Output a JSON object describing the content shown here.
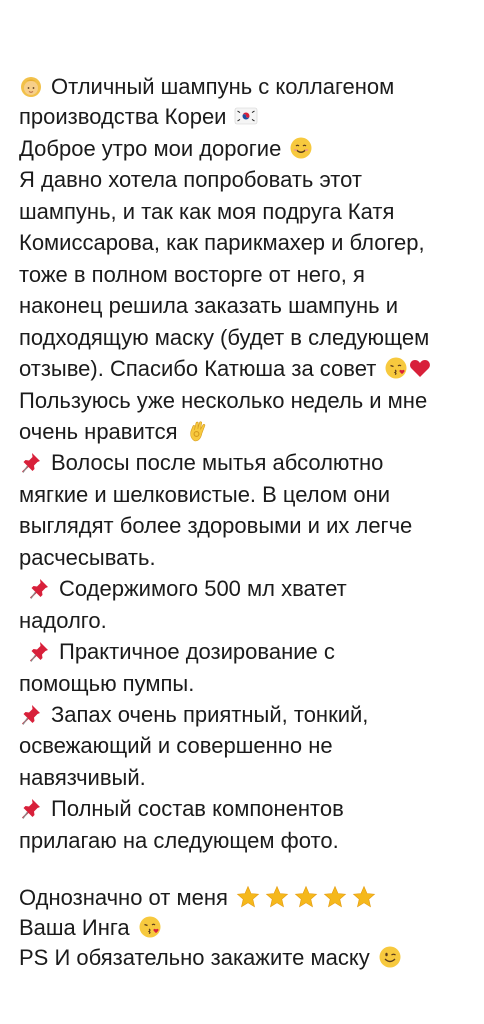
{
  "lines": [
    "Отличный шампунь с коллагеном",
    "производства Кореи",
    "Доброе утро мои дорогие",
    "Я давно хотела попробовать этот",
    "шампунь, и так как моя подруга Катя",
    "Комиссарова, как парикмахер и блогер,",
    "тоже в полном восторге от него, я",
    "наконец решила заказать шампунь и",
    "подходящую маску (будет в следующем",
    "отзыве). Спасибо Катюша за совет",
    "Пользуюсь уже несколько недель и мне",
    "очень нравится",
    "Волосы после мытья абсолютно",
    "мягкие и шелковистые. В целом они",
    "выглядят более здоровыми и их легче",
    "расчесывать.",
    "Содержимого 500 мл хватет",
    "надолго.",
    "Практичное дозирование с",
    "помощью пумпы.",
    "Запах очень приятный, тонкий,",
    "освежающий и совершенно не",
    "навязчивый.",
    "Полный состав компонентов",
    "прилагаю на следующем фото.",
    "Однозначно от меня",
    "Ваша Инга",
    "PS И обязательно закажите маску"
  ],
  "emojis": {
    "person": "woman-blond-icon",
    "flag": "south-korea-flag-icon",
    "smile": "smiling-face-icon",
    "kiss": "face-blowing-kiss-icon",
    "heart": "red-heart-icon",
    "ok": "ok-hand-icon",
    "pin": "pushpin-icon",
    "star": "star-icon",
    "wink": "winking-face-icon"
  },
  "rating_stars": 5,
  "colors": {
    "text": "#1b1b1b",
    "background": "#ffffff",
    "star": "#f5b81c",
    "heart": "#d8203a",
    "pin": "#d8203a",
    "face": "#f7c93e"
  }
}
